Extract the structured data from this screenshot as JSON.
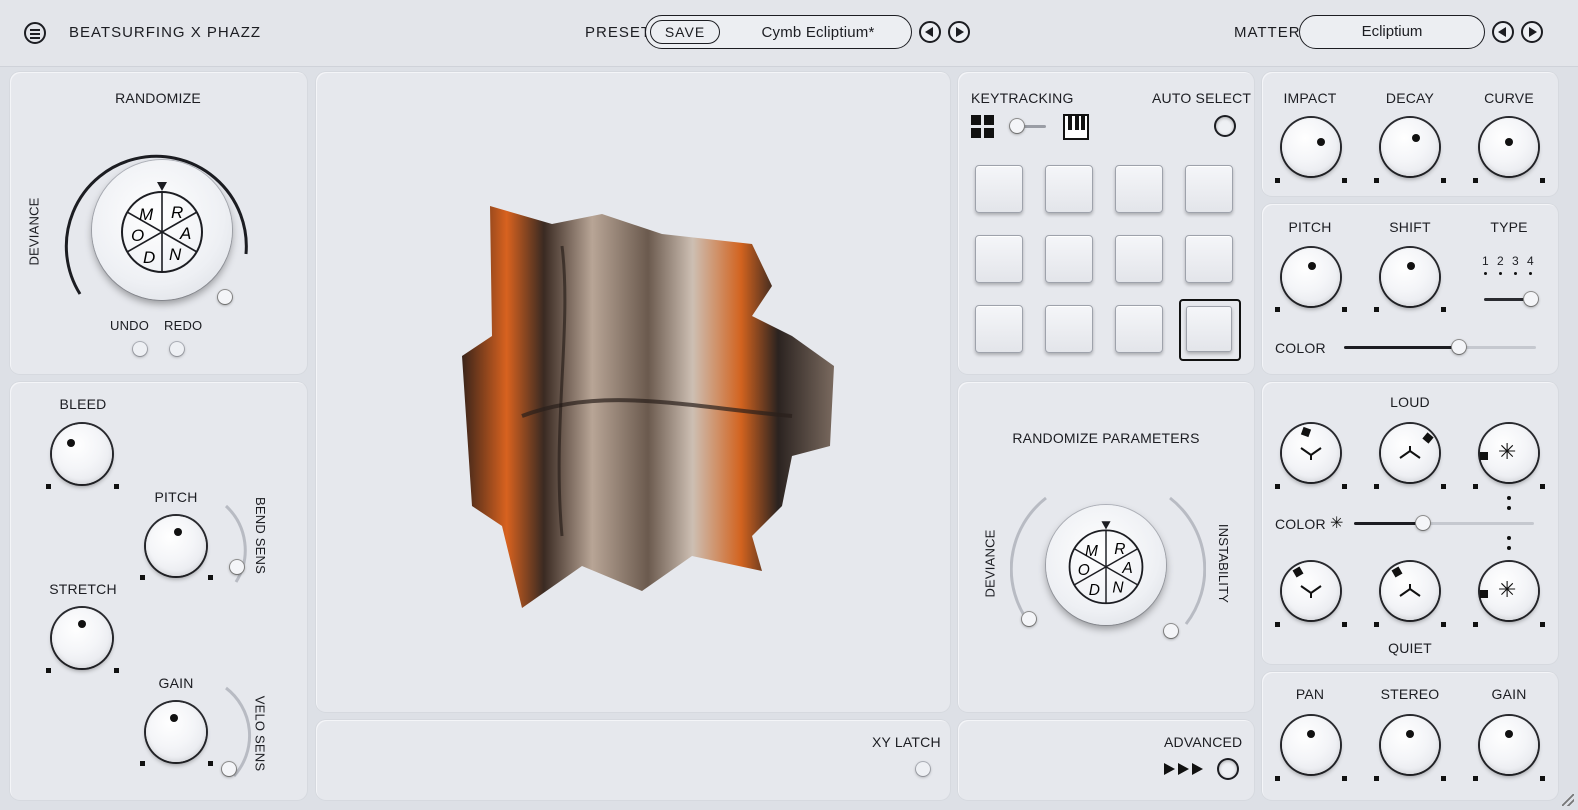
{
  "header": {
    "brand": "BEATSURFING X PHAZZ",
    "preset_label": "PRESET",
    "save_label": "SAVE",
    "preset_name": "Cymb Ecliptium*",
    "matter_label": "MATTER",
    "matter_name": "Ecliptium"
  },
  "randomize": {
    "title": "RANDOMIZE",
    "deviance": "DEVIANCE",
    "undo": "UNDO",
    "redo": "REDO",
    "wheel_letters": [
      "R",
      "A",
      "N",
      "D",
      "O",
      "M"
    ]
  },
  "left": {
    "bleed": "BLEED",
    "pitch": "PITCH",
    "bend_sens": "BEND SENS",
    "stretch": "STRETCH",
    "gain": "GAIN",
    "velo_sens": "VELO SENS"
  },
  "center": {
    "xy_latch": "XY LATCH"
  },
  "keys": {
    "keytracking": "KEYTRACKING",
    "auto_select": "AUTO SELECT"
  },
  "rand_params": {
    "title": "RANDOMIZE PARAMETERS",
    "deviance": "DEVIANCE",
    "instability": "INSTABILITY",
    "advanced": "ADVANCED"
  },
  "right": {
    "impact": "IMPACT",
    "decay": "DECAY",
    "curve": "CURVE",
    "pitch": "PITCH",
    "shift": "SHIFT",
    "type": "TYPE",
    "type_nums": [
      "1",
      "2",
      "3",
      "4"
    ],
    "color": "COLOR",
    "loud": "LOUD",
    "color2": "COLOR",
    "quiet": "QUIET",
    "pan": "PAN",
    "stereo": "STEREO",
    "gain": "GAIN"
  },
  "colors": {
    "accent": "#1c1d22",
    "copper": "#c4561b",
    "panel": "#e6e8ed"
  }
}
